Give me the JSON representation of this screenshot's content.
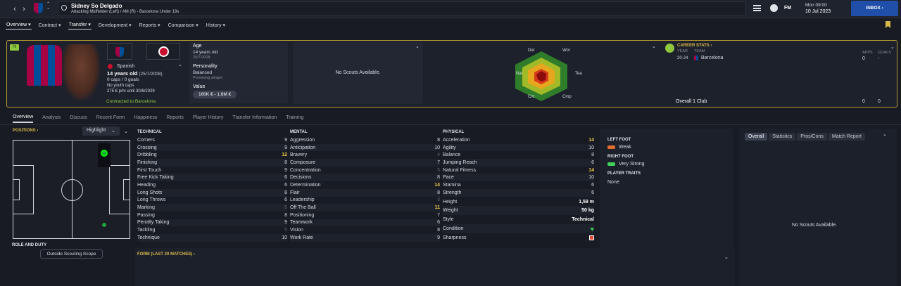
{
  "topbar": {
    "name": "Sidney So Delgado",
    "desc": "Attacking Midfielder (Left) / AM (R) - Barcelona Under 19s",
    "day": "Mon 09:00",
    "date": "10 Jul 2023",
    "inbox": "INBOX",
    "fm": "FM"
  },
  "menu": [
    {
      "label": "Overview",
      "active": true
    },
    {
      "label": "Contract"
    },
    {
      "label": "Transfer",
      "active": true
    },
    {
      "label": "Development"
    },
    {
      "label": "Reports"
    },
    {
      "label": "Comparison"
    },
    {
      "label": "History"
    }
  ],
  "player": {
    "nationality": "Spanish",
    "age_line": "14 years old",
    "dob_paren": "(25/7/2008)",
    "caps": "0 caps / 0 goals",
    "youth": "No youth caps",
    "wage": "275 € p/m until 30/6/2029",
    "contract": "Contracted to Barcelona",
    "badge": "76"
  },
  "info": {
    "age_label": "Age",
    "age": "14 years old",
    "dob": "25/7/2008",
    "pers_label": "Personality",
    "pers": "Balanced",
    "pers_sub": "Promising winger",
    "value_label": "Value",
    "value": "160K € - 1,6M €"
  },
  "scouts": "No Scouts Available.",
  "radar": {
    "labels": [
      "Det",
      "Wor",
      "Tea",
      "Cmp",
      "Cnt",
      "Nat"
    ]
  },
  "career": {
    "title": "CAREER STATS",
    "year_h": "YEAR",
    "team_h": "TEAM",
    "apps_h": "APPS",
    "goals_h": "GOALS",
    "year": "20-24",
    "team": "Barcelona",
    "apps": "0",
    "goals": "-",
    "overall": "Overall 1 Club",
    "o_apps": "0",
    "o_goals": "0"
  },
  "tabs": [
    {
      "label": "Overview",
      "active": true
    },
    {
      "label": "Analysis"
    },
    {
      "label": "Discuss"
    },
    {
      "label": "Recent Form"
    },
    {
      "label": "Happiness"
    },
    {
      "label": "Reports"
    },
    {
      "label": "Player History"
    },
    {
      "label": "Transfer Information"
    },
    {
      "label": "Training"
    }
  ],
  "positions": {
    "title": "POSITIONS",
    "mode": "Highlight",
    "role_title": "ROLE AND DUTY",
    "role_btn": "Outside Scouting Scope"
  },
  "technical": {
    "title": "TECHNICAL",
    "rows": [
      [
        "Corners",
        "9",
        ""
      ],
      [
        "Crossing",
        "9",
        ""
      ],
      [
        "Dribbling",
        "12",
        "hi"
      ],
      [
        "Finishing",
        "8",
        ""
      ],
      [
        "First Touch",
        "9",
        ""
      ],
      [
        "Free Kick Taking",
        "6",
        ""
      ],
      [
        "Heading",
        "6",
        ""
      ],
      [
        "Long Shots",
        "8",
        ""
      ],
      [
        "Long Throws",
        "6",
        ""
      ],
      [
        "Marking",
        "5",
        "lo"
      ],
      [
        "Passing",
        "8",
        ""
      ],
      [
        "Penalty Taking",
        "9",
        ""
      ],
      [
        "Tackling",
        "5",
        "lo"
      ],
      [
        "Technique",
        "10",
        ""
      ]
    ]
  },
  "mental": {
    "title": "MENTAL",
    "rows": [
      [
        "Aggression",
        "8",
        ""
      ],
      [
        "Anticipation",
        "10",
        ""
      ],
      [
        "Bravery",
        "4",
        "lo"
      ],
      [
        "Composure",
        "7",
        ""
      ],
      [
        "Concentration",
        "5",
        "lo"
      ],
      [
        "Decisions",
        "8",
        ""
      ],
      [
        "Determination",
        "14",
        "hi"
      ],
      [
        "Flair",
        "8",
        ""
      ],
      [
        "Leadership",
        "3",
        "lo"
      ],
      [
        "Off The Ball",
        "11",
        "hi"
      ],
      [
        "Positioning",
        "7",
        ""
      ],
      [
        "Teamwork",
        "6",
        ""
      ],
      [
        "Vision",
        "8",
        ""
      ],
      [
        "Work Rate",
        "9",
        ""
      ]
    ]
  },
  "physical": {
    "title": "PHYSICAL",
    "rows": [
      [
        "Acceleration",
        "14",
        "hi"
      ],
      [
        "Agility",
        "10",
        ""
      ],
      [
        "Balance",
        "8",
        ""
      ],
      [
        "Jumping Reach",
        "6",
        ""
      ],
      [
        "Natural Fitness",
        "14",
        "hi"
      ],
      [
        "Pace",
        "10",
        ""
      ],
      [
        "Stamina",
        "6",
        ""
      ],
      [
        "Strength",
        "6",
        ""
      ]
    ],
    "height_l": "Height",
    "height": "1,59 m",
    "weight_l": "Weight",
    "weight": "50 kg",
    "style_l": "Style",
    "style": "Technical",
    "cond_l": "Condition",
    "sharp_l": "Sharpness"
  },
  "feet": {
    "left_t": "LEFT FOOT",
    "left": "Weak",
    "right_t": "RIGHT FOOT",
    "right": "Very Strong",
    "traits_t": "PLAYER TRAITS",
    "traits": "None"
  },
  "form_title": "FORM (LAST 20 MATCHES)",
  "rightpanel": {
    "segs": [
      "Overall",
      "Statistics",
      "Pros/Cons",
      "Match Report"
    ],
    "empty": "No Scouts Available."
  },
  "colors": {
    "accent": "#b69b2f",
    "inbox": "#1f4fa8",
    "highlight": "#e8c84a"
  }
}
